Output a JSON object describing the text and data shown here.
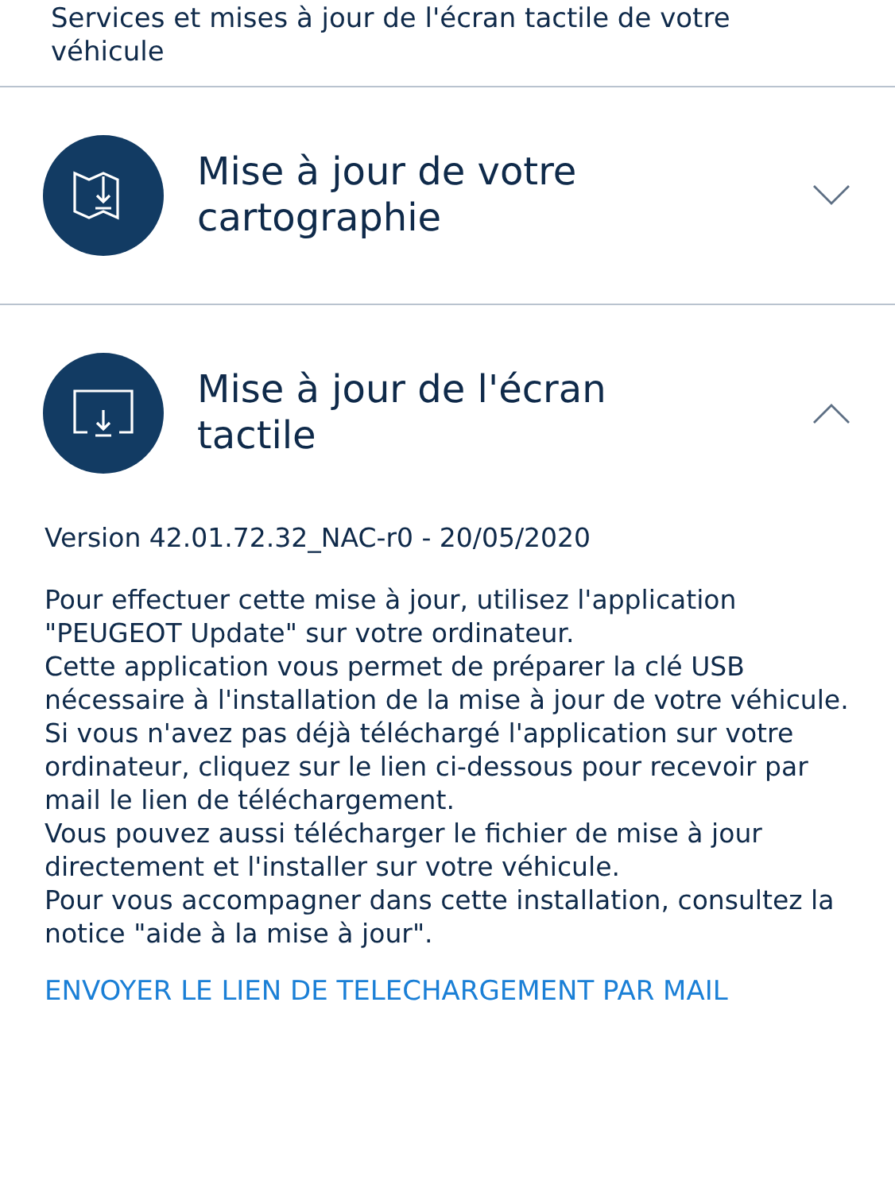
{
  "intro": "Services et mises à jour de l'écran tactile de votre véhicule",
  "sections": [
    {
      "kind": "map",
      "title": "Mise à jour de votre cartographie",
      "expanded": false
    },
    {
      "kind": "screen",
      "title": "Mise à jour de l'écran tactile",
      "expanded": true,
      "version": "Version 42.01.72.32_NAC-r0 - 20/05/2020",
      "paragraphs": [
        "Pour effectuer cette mise à jour, utilisez l'application \"PEUGEOT Update\" sur votre ordinateur.",
        "Cette application vous permet de préparer la clé USB nécessaire à l'installation de la mise à jour de votre véhicule.",
        "Si vous n'avez pas déjà téléchargé l'application sur votre ordinateur, cliquez sur le lien ci-dessous pour recevoir par mail le lien de téléchargement.",
        "Vous pouvez aussi télécharger le fichier de mise à jour directement et l'installer sur votre véhicule.",
        "Pour vous accompagner dans cette installation, consultez la notice \"aide à la mise à jour\"."
      ],
      "link": "ENVOYER LE LIEN DE TELECHARGEMENT PAR MAIL"
    }
  ]
}
